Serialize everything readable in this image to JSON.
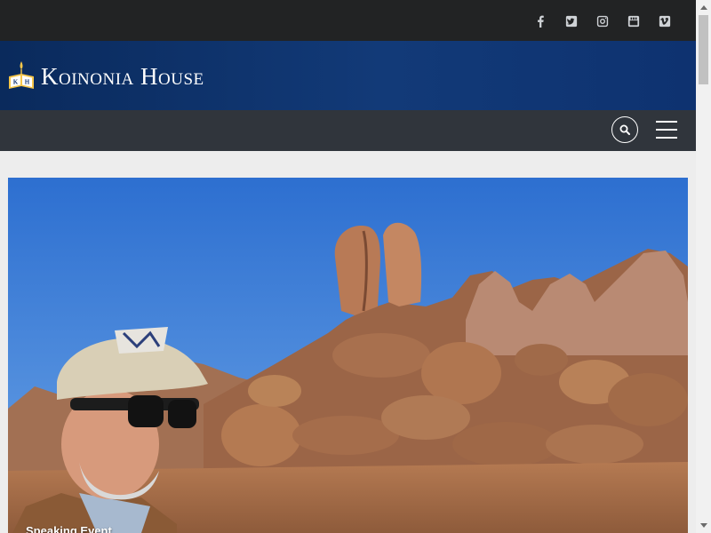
{
  "social": {
    "items": [
      {
        "name": "facebook",
        "glyph": "f"
      },
      {
        "name": "twitter",
        "glyph": "t"
      },
      {
        "name": "instagram",
        "glyph": "i"
      },
      {
        "name": "youtube",
        "glyph": "y"
      },
      {
        "name": "vimeo",
        "glyph": "v"
      }
    ]
  },
  "brand": {
    "name": "Koinonia House",
    "logo_letters": "KH"
  },
  "nav": {
    "search_icon": "search-icon",
    "menu_icon": "hamburger-menu-icon"
  },
  "hero": {
    "caption": "Speaking Event"
  },
  "colors": {
    "topbar": "#222324",
    "brandbar": "#123a78",
    "navbar": "#30353c",
    "sky": "#3f7ed4",
    "rock": "#a8744f"
  }
}
